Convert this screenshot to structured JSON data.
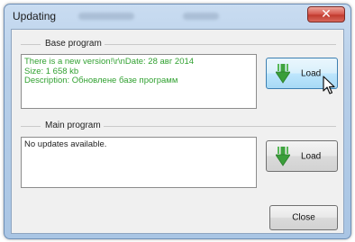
{
  "window": {
    "title": "Updating",
    "close_glyph": "✕"
  },
  "base_program": {
    "group_title": "Base program",
    "text_lines": [
      "There is a new version!\\r\\nDate: 28 авг 2014",
      "Size: 1 658 kb",
      "Description: Обновлене базе программ"
    ],
    "text_color": "#31a131",
    "load_label": "Load"
  },
  "main_program": {
    "group_title": "Main program",
    "text_lines": [
      "No updates available."
    ],
    "load_label": "Load"
  },
  "footer": {
    "close_label": "Close"
  },
  "icons": {
    "load": "green-down-arrow-icon",
    "cursor": "mouse-pointer-icon"
  }
}
